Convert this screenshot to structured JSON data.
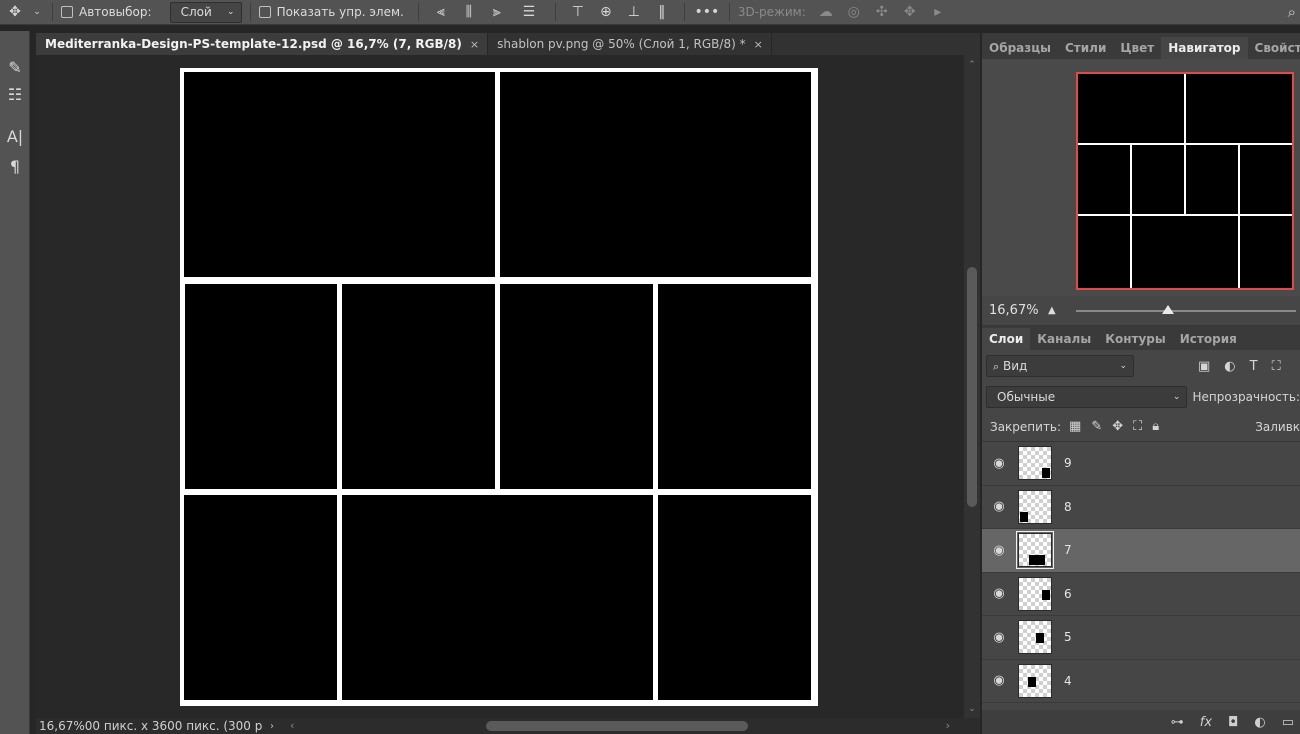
{
  "options_bar": {
    "move_icon": "move-tool-icon",
    "auto_select_label": "Автовыбор:",
    "auto_select_value": "Слой",
    "show_transform_label": "Показать упр. элем.",
    "mode3d_label": "3D-режим:"
  },
  "tabs": [
    {
      "label": "Mediterranka-Design-PS-template-12.psd @ 16,7% (7, RGB/8)",
      "close": "×"
    },
    {
      "label": "shablon pv.png @ 50% (Слой 1, RGB/8) *",
      "close": "×"
    }
  ],
  "status": {
    "text": "16,67%",
    "doc_info": "00 пикс. x 3600 пикс. (300 p"
  },
  "top_panel_tabs": [
    "Образцы",
    "Стили",
    "Цвет",
    "Навигатор",
    "Свойства"
  ],
  "navigator": {
    "zoom": "16,67%",
    "slider_position": 0.42
  },
  "layer_panel_tabs": [
    "Слои",
    "Каналы",
    "Контуры",
    "История"
  ],
  "layers_panel": {
    "filter_label": "Вид",
    "blend_mode": "Обычные",
    "opacity_label": "Непрозрачность:",
    "lock_label": "Закрепить:",
    "fill_label": "Заливка:"
  },
  "layers": [
    {
      "name": "9",
      "selected": false
    },
    {
      "name": "8",
      "selected": false
    },
    {
      "name": "7",
      "selected": true
    },
    {
      "name": "6",
      "selected": false
    },
    {
      "name": "5",
      "selected": false
    },
    {
      "name": "4",
      "selected": false
    }
  ],
  "colors": {
    "accent_nav_frame": "#e24a4a",
    "selected_layer": "#666666"
  }
}
